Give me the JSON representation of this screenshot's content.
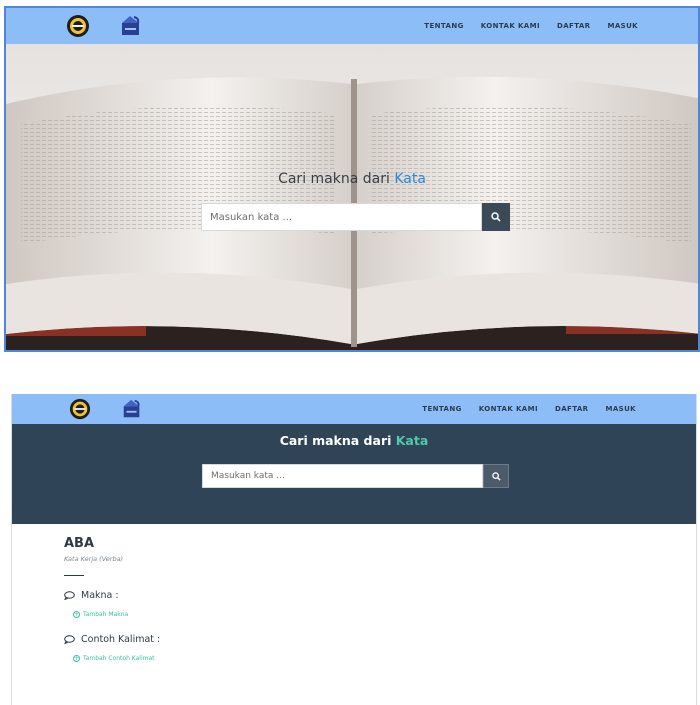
{
  "nav": {
    "links": [
      "TENTANG",
      "KONTAK KAMI",
      "DAFTAR",
      "MASUK"
    ]
  },
  "hero": {
    "title_prefix": "Cari makna dari ",
    "title_keyword": "Kata",
    "search_placeholder": "Masukan kata ..."
  },
  "result": {
    "word": "ABA",
    "word_type": "Kata Kerja (Verba)",
    "makna_label": "Makna :",
    "add_makna": "Tambah Makna",
    "contoh_label": "Contoh Kalimat :",
    "add_contoh": "Tambah Contoh Kalimat"
  },
  "icons": {
    "search": "search-icon",
    "comment": "comment-icon",
    "plus": "plus-circle-icon"
  },
  "colors": {
    "nav_bg": "#8dbdf7",
    "dark_hero": "#2f4456",
    "accent_blue": "#2e88d6",
    "accent_green": "#37c2a0",
    "border_blue": "#4f86d9"
  }
}
